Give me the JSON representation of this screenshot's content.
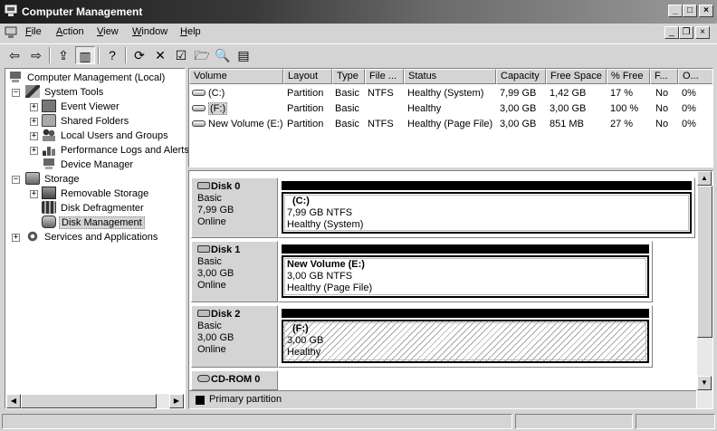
{
  "window": {
    "title": "Computer Management",
    "minimize_glyph": "_",
    "maximize_glyph": "□",
    "close_glyph": "×"
  },
  "menu": [
    {
      "label": "File",
      "underline": "F",
      "rest": "ile"
    },
    {
      "label": "Action",
      "underline": "A",
      "rest": "ction"
    },
    {
      "label": "View",
      "underline": "V",
      "rest": "iew"
    },
    {
      "label": "Window",
      "underline": "W",
      "rest": "indow"
    },
    {
      "label": "Help",
      "underline": "H",
      "rest": "elp"
    }
  ],
  "mdi": {
    "minimize_glyph": "_",
    "restore_glyph": "❐",
    "close_glyph": "×"
  },
  "toolbar": [
    {
      "name": "back",
      "icon": "arrow-left-icon",
      "glyph": "⇦"
    },
    {
      "name": "forward",
      "icon": "arrow-right-icon",
      "glyph": "⇨"
    },
    {
      "name": "up-one-level",
      "icon": "folder-up-icon",
      "glyph": "⇪"
    },
    {
      "name": "show-hide-tree",
      "icon": "tree-toggle-icon",
      "glyph": "▥"
    },
    {
      "name": "help",
      "icon": "help-icon",
      "glyph": "?"
    },
    {
      "name": "refresh",
      "icon": "refresh-icon",
      "glyph": "⟳"
    },
    {
      "name": "delete",
      "icon": "delete-icon",
      "glyph": "✕"
    },
    {
      "name": "properties",
      "icon": "properties-icon",
      "glyph": "☑"
    },
    {
      "name": "open",
      "icon": "open-folder-icon",
      "glyph": "🗁"
    },
    {
      "name": "search",
      "icon": "search-icon",
      "glyph": "🔍"
    },
    {
      "name": "export",
      "icon": "export-list-icon",
      "glyph": "▤"
    }
  ],
  "tree": {
    "root": "Computer Management (Local)",
    "system_tools": "System Tools",
    "event_viewer": "Event Viewer",
    "shared_folders": "Shared Folders",
    "local_users": "Local Users and Groups",
    "perf_logs": "Performance Logs and Alerts",
    "device_manager": "Device Manager",
    "storage": "Storage",
    "removable_storage": "Removable Storage",
    "disk_defrag": "Disk Defragmenter",
    "disk_management": "Disk Management",
    "services": "Services and Applications"
  },
  "volume_list": {
    "columns": [
      "Volume",
      "Layout",
      "Type",
      "File ...",
      "Status",
      "Capacity",
      "Free Space",
      "% Free",
      "F...",
      "O..."
    ],
    "rows": [
      [
        "(C:)",
        "Partition",
        "Basic",
        "NTFS",
        "Healthy (System)",
        "7,99 GB",
        "1,42 GB",
        "17 %",
        "No",
        "0%"
      ],
      [
        "(F:)",
        "Partition",
        "Basic",
        "",
        "Healthy",
        "3,00 GB",
        "3,00 GB",
        "100 %",
        "No",
        "0%"
      ],
      [
        "New Volume (E:)",
        "Partition",
        "Basic",
        "NTFS",
        "Healthy (Page File)",
        "3,00 GB",
        "851 MB",
        "27 %",
        "No",
        "0%"
      ]
    ]
  },
  "disks": [
    {
      "name": "Disk 0",
      "type": "Basic",
      "size": "7,99 GB",
      "status": "Online",
      "partition": {
        "name": "(C:)",
        "size": "7,99 GB NTFS",
        "status": "Healthy (System)"
      }
    },
    {
      "name": "Disk 1",
      "type": "Basic",
      "size": "3,00 GB",
      "status": "Online",
      "partition": {
        "name": "New Volume  (E:)",
        "size": "3,00 GB NTFS",
        "status": "Healthy (Page File)"
      }
    },
    {
      "name": "Disk 2",
      "type": "Basic",
      "size": "3,00 GB",
      "status": "Online",
      "partition": {
        "name": "(F:)",
        "size": "3,00 GB",
        "status": "Healthy"
      }
    },
    {
      "name": "CD-ROM 0"
    }
  ],
  "legend": {
    "label": "Primary partition",
    "color": "#000000"
  }
}
